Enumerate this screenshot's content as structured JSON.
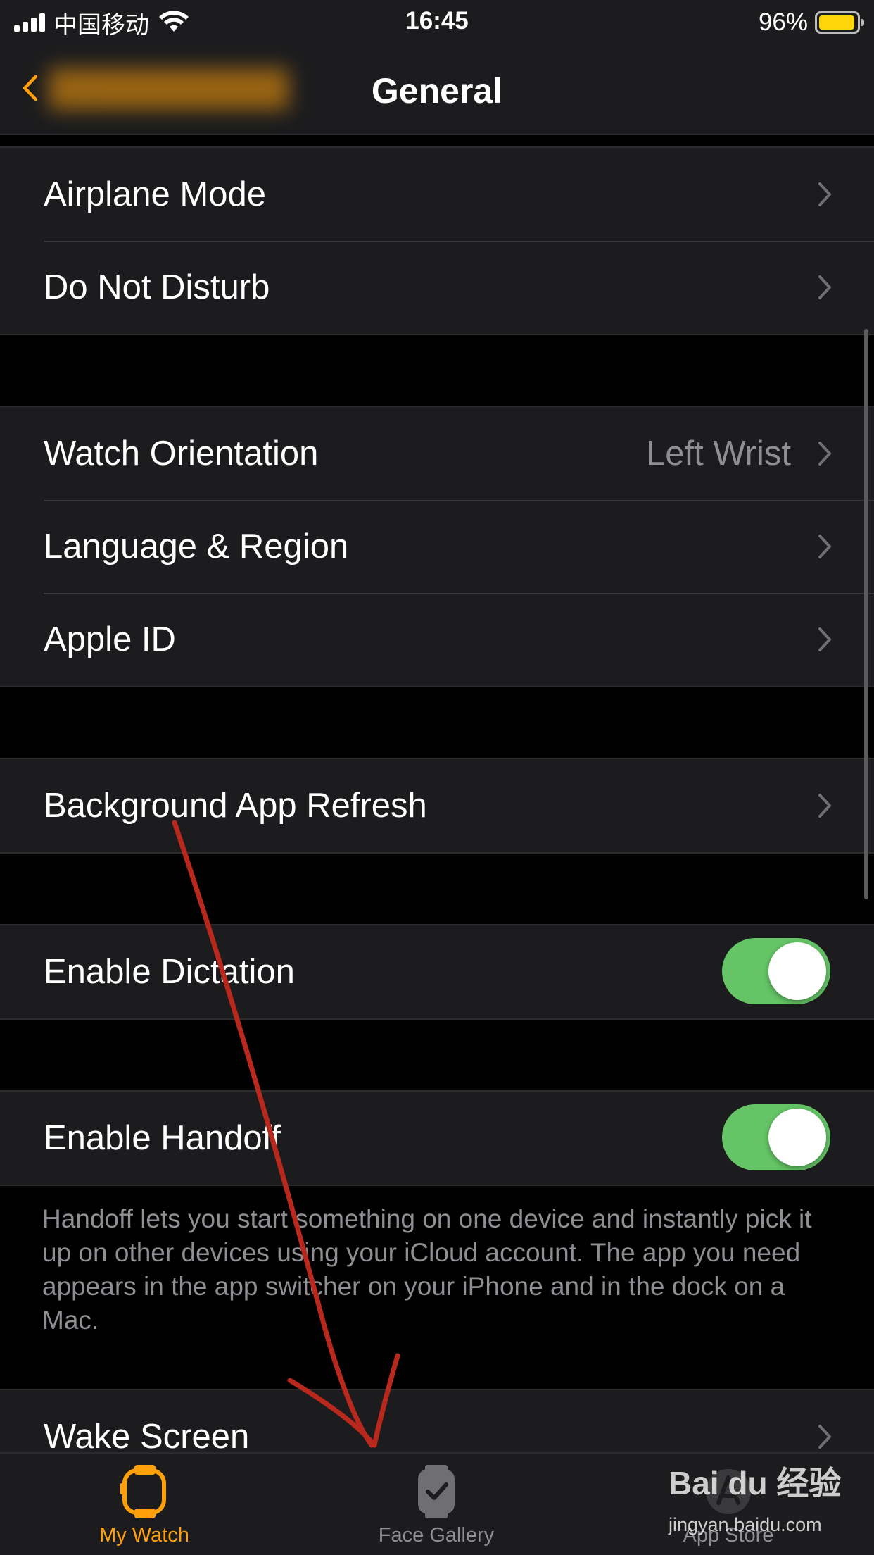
{
  "status_bar": {
    "carrier": "中国移动",
    "time": "16:45",
    "battery_percent": "96%",
    "battery_level": 0.96,
    "battery_color": "#ffd60a"
  },
  "nav": {
    "back_icon": "chevron-left-icon",
    "title": "General"
  },
  "groups": [
    {
      "rows": [
        {
          "label": "Airplane Mode",
          "accessory": "chevron"
        },
        {
          "label": "Do Not Disturb",
          "accessory": "chevron"
        }
      ]
    },
    {
      "rows": [
        {
          "label": "Watch Orientation",
          "value": "Left Wrist",
          "accessory": "chevron"
        },
        {
          "label": "Language & Region",
          "accessory": "chevron"
        },
        {
          "label": "Apple ID",
          "accessory": "chevron"
        }
      ]
    },
    {
      "rows": [
        {
          "label": "Background App Refresh",
          "accessory": "chevron"
        }
      ]
    },
    {
      "rows": [
        {
          "label": "Enable Dictation",
          "accessory": "toggle",
          "on": true
        }
      ]
    },
    {
      "rows": [
        {
          "label": "Enable Handoff",
          "accessory": "toggle",
          "on": true
        }
      ],
      "footer": "Handoff lets you start something on one device and instantly pick it up on other devices using your iCloud account. The app you need appears in the app switcher on your iPhone and in the dock on a Mac."
    },
    {
      "rows": [
        {
          "label": "Wake Screen",
          "accessory": "chevron"
        }
      ]
    }
  ],
  "tab_bar": {
    "tabs": [
      {
        "label": "My Watch",
        "icon": "watch-icon",
        "selected": true
      },
      {
        "label": "Face Gallery",
        "icon": "watch-face-gallery-icon",
        "selected": false
      },
      {
        "label": "App Store",
        "icon": "app-store-icon",
        "selected": false
      }
    ]
  },
  "watermark": {
    "brand": "Bai du 经验",
    "url": "jingyan.baidu.com"
  },
  "colors": {
    "accent": "#ff9f0a",
    "toggle_on": "#65c466",
    "annotation_arrow": "#b8281c",
    "cell_background": "#1c1c1e",
    "secondary_text": "#8e8e93"
  }
}
